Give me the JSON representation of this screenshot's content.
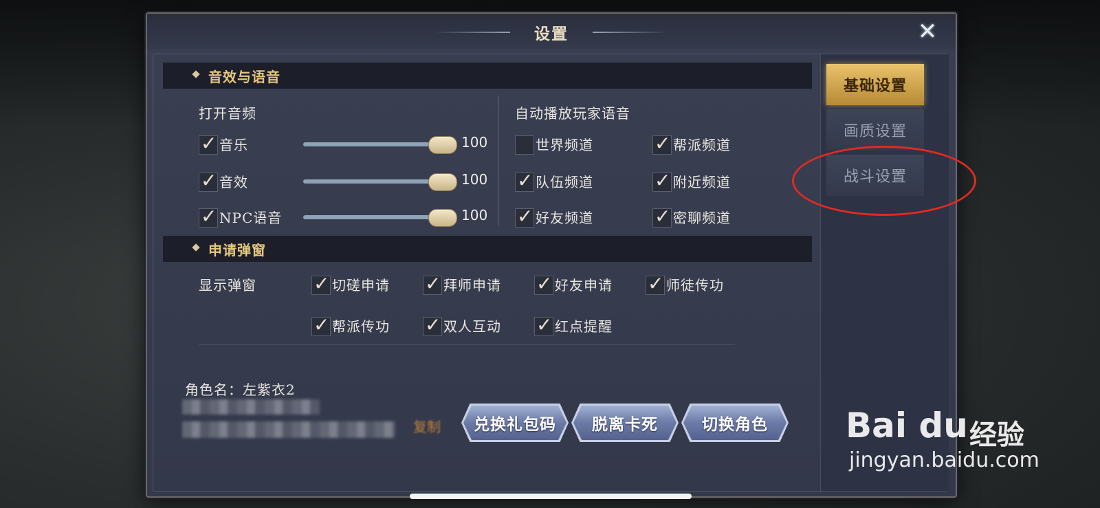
{
  "dialog": {
    "title": "设置",
    "close_icon": "close-x-icon"
  },
  "sections": {
    "audio": {
      "title": "音效与语音"
    },
    "popups": {
      "title": "申请弹窗"
    }
  },
  "audio": {
    "open_label": "打开音频",
    "rows": [
      {
        "label": "音乐",
        "checked": true,
        "value": "100",
        "level": 1.0
      },
      {
        "label": "音效",
        "checked": true,
        "value": "100",
        "level": 1.0
      },
      {
        "label": "NPC语音",
        "checked": true,
        "value": "100",
        "level": 1.0
      }
    ]
  },
  "voice": {
    "label": "自动播放玩家语音",
    "channels": [
      {
        "label": "世界频道",
        "checked": false
      },
      {
        "label": "帮派频道",
        "checked": true
      },
      {
        "label": "队伍频道",
        "checked": true
      },
      {
        "label": "附近频道",
        "checked": true
      },
      {
        "label": "好友频道",
        "checked": true
      },
      {
        "label": "密聊频道",
        "checked": true
      }
    ]
  },
  "popup": {
    "label": "显示弹窗",
    "items": [
      {
        "label": "切磋申请",
        "checked": true
      },
      {
        "label": "拜师申请",
        "checked": true
      },
      {
        "label": "好友申请",
        "checked": true
      },
      {
        "label": "师徒传功",
        "checked": true
      },
      {
        "label": "帮派传功",
        "checked": true
      },
      {
        "label": "双人互动",
        "checked": true
      },
      {
        "label": "红点提醒",
        "checked": true
      }
    ]
  },
  "account": {
    "role_name": "角色名：左紫衣2",
    "copy_label": "复制"
  },
  "buttons": {
    "redeem": "兑换礼包码",
    "unstuck": "脱离卡死",
    "switch_role": "切换角色"
  },
  "tabs": [
    {
      "label": "基础设置",
      "active": true
    },
    {
      "label": "画质设置",
      "active": false
    },
    {
      "label": "战斗设置",
      "active": false
    }
  ],
  "watermark": {
    "logo": "Bai du",
    "cn": "经验",
    "url": "jingyan.baidu.com"
  },
  "colors": {
    "accent_gold": "#e5c77e",
    "annotation_red": "#e02a22",
    "button_blue": "#6b7aa6"
  }
}
